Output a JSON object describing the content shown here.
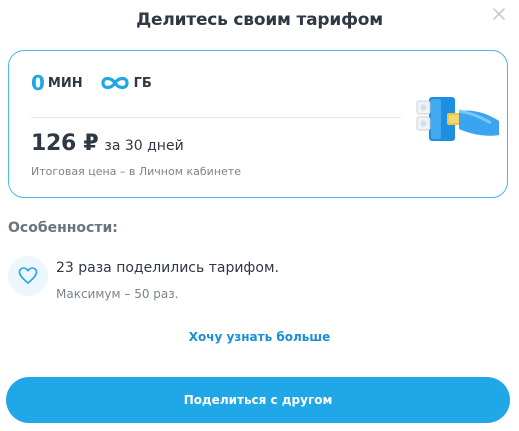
{
  "dialog": {
    "title": "Делитесь своим тарифом",
    "close_icon": "close-icon"
  },
  "tariff": {
    "minutes_value": "0",
    "minutes_unit": "МИН",
    "gb_icon": "infinity-icon",
    "gb_unit": "ГБ",
    "price": "126 ₽",
    "period": "за 30 дней",
    "price_note": "Итоговая цена – в Личном кабинете",
    "illustration": "blocks-illustration"
  },
  "features": {
    "title": "Особенности:",
    "items": [
      {
        "icon": "heart-icon",
        "text": "23 раза поделились тарифом.",
        "subtext": "Максимум – 50 раз."
      }
    ]
  },
  "actions": {
    "learn_more": "Хочу узнать больше",
    "share": "Поделиться с другом"
  },
  "colors": {
    "accent": "#1fa7e8",
    "border": "#4ab8ec",
    "text": "#2f3844",
    "muted": "#7b838e"
  }
}
